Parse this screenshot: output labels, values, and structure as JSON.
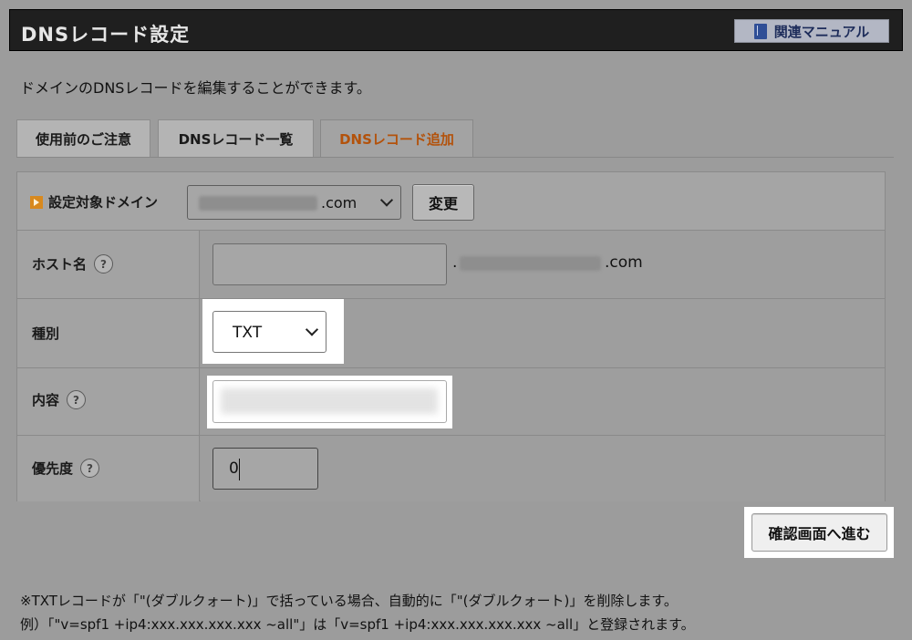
{
  "header": {
    "title": "DNSレコード設定",
    "manual_label": "関連マニュアル"
  },
  "description": "ドメインのDNSレコードを編集することができます。",
  "tabs": [
    {
      "label": "使用前のご注意",
      "active": false
    },
    {
      "label": "DNSレコード一覧",
      "active": false
    },
    {
      "label": "DNSレコード追加",
      "active": true
    }
  ],
  "domain_row": {
    "label": "設定対象ドメイン",
    "selected_domain_suffix": ".com",
    "change_button": "変更"
  },
  "form": {
    "host": {
      "label": "ホスト名",
      "help": "?",
      "value": "",
      "domain_suffix": ".com",
      "dot": "."
    },
    "type": {
      "label": "種別",
      "selected": "TXT"
    },
    "content": {
      "label": "内容",
      "help": "?",
      "value": ""
    },
    "priority": {
      "label": "優先度",
      "help": "?",
      "value": "0"
    }
  },
  "confirm_button": "確認画面へ進む",
  "notes": [
    "※TXTレコードが「\"(ダブルクォート)」で括っている場合、自動的に「\"(ダブルクォート)」を削除します。",
    "例）「\"v=spf1 +ip4:xxx.xxx.xxx.xxx ~all\"」は「v=spf1 +ip4:xxx.xxx.xxx.xxx ~all」と登録されます。"
  ],
  "colors": {
    "active_tab_text": "#b3520b",
    "header_bg": "#1f1f1f",
    "highlight": "#ffffff"
  }
}
